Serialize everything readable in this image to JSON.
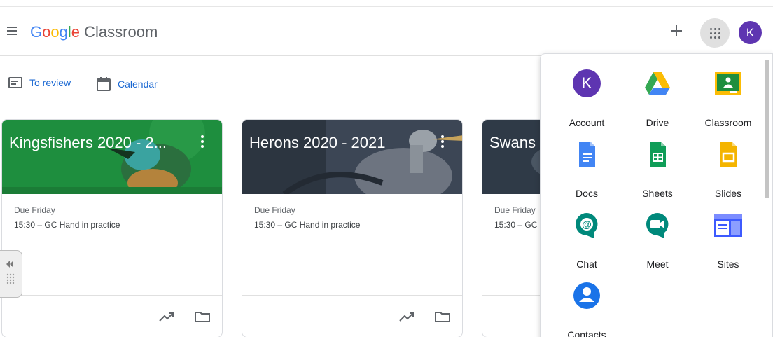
{
  "header": {
    "brand_google": [
      "G",
      "o",
      "o",
      "g",
      "l",
      "e"
    ],
    "brand_product": "Classroom",
    "avatar_letter": "K"
  },
  "subnav": {
    "to_review": "To review",
    "calendar": "Calendar"
  },
  "cards": [
    {
      "title": "Kingsfishers 2020 - 2...",
      "due": "Due Friday",
      "task": "15:30 – GC Hand in practice",
      "banner_color": "#1e8e3e"
    },
    {
      "title": "Herons 2020 - 2021",
      "due": "Due Friday",
      "task": "15:30 – GC Hand in practice",
      "banner_color": "#3c4655"
    },
    {
      "title": "Swans",
      "due": "Due Friday",
      "task": "15:30 – GC",
      "banner_color": "#2f3a47"
    }
  ],
  "launcher": {
    "apps": [
      {
        "label": "Account",
        "icon": "account-icon",
        "letter": "K"
      },
      {
        "label": "Drive",
        "icon": "drive-icon"
      },
      {
        "label": "Classroom",
        "icon": "classroom-icon"
      },
      {
        "label": "Docs",
        "icon": "docs-icon"
      },
      {
        "label": "Sheets",
        "icon": "sheets-icon"
      },
      {
        "label": "Slides",
        "icon": "slides-icon"
      },
      {
        "label": "Chat",
        "icon": "chat-icon"
      },
      {
        "label": "Meet",
        "icon": "meet-icon"
      },
      {
        "label": "Sites",
        "icon": "sites-icon"
      },
      {
        "label": "Contacts",
        "icon": "contacts-icon"
      }
    ]
  },
  "colors": {
    "accent_blue": "#1967d2",
    "avatar_purple": "#5e35b1",
    "kingfisher_green": "#1e8e3e",
    "heron_slate": "#3c4655"
  }
}
